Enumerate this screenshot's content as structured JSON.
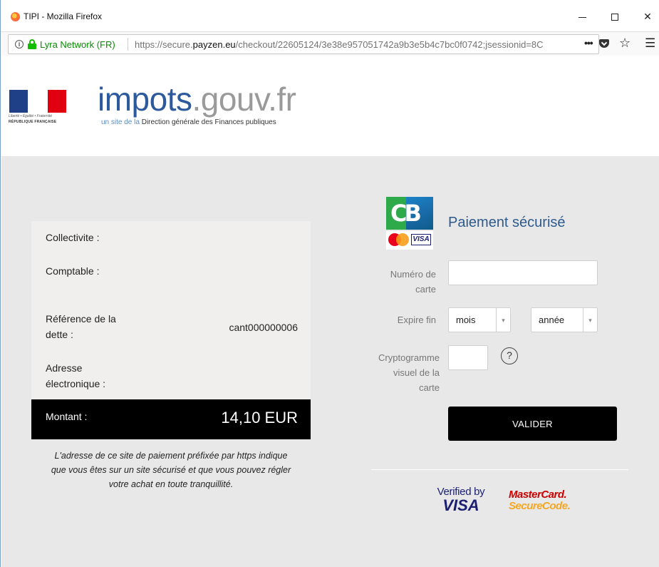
{
  "browser": {
    "window_title": "TIPI - Mozilla Firefox",
    "site_identity": "Lyra Network (FR)",
    "url_prefix": "https://secure.",
    "url_domain": "payzen.eu",
    "url_path": "/checkout/22605124/3e38e957051742a9b3e5b4c7bc0f0742;jsessionid=8C",
    "more_label": "•••",
    "icons": [
      "firefox-icon",
      "info-icon",
      "lock-icon",
      "pocket-icon",
      "star-icon",
      "menu-icon"
    ]
  },
  "header": {
    "brand_impots": "impots",
    "brand_dot": ".",
    "brand_gouv": "gouv.fr",
    "tagline_light": "un site de la",
    "tagline_dark": "Direction générale des Finances publiques",
    "motto": "Liberté • Égalité • Fraternité",
    "republique": "RÉPUBLIQUE FRANÇAISE",
    "flag_colors": [
      "#1f3f86",
      "#ffffff",
      "#e1000f"
    ]
  },
  "summary": {
    "collectivite_label": "Collectivite :",
    "comptable_label": "Comptable :",
    "reference_label_line1": "Référence de la",
    "reference_label_line2": "dette :",
    "reference_value": "cant000000006",
    "email_label_line1": "Adresse",
    "email_label_line2": "électronique :",
    "amount_label": "Montant :",
    "amount_value": "14,10 EUR",
    "note_line1": "L'adresse de ce site de paiement préfixée par https indique",
    "note_line2": "que vous êtes sur un site sécurisé et que vous pouvez régler",
    "note_line3": "votre achat en toute tranquillité."
  },
  "payment": {
    "title": "Paiement sécurisé",
    "cb_logo_text": "CB",
    "visa_mini": "VISA",
    "card_number_label_line1": "Numéro de",
    "card_number_label_line2": "carte",
    "card_number_value": "",
    "expire_label": "Expire fin",
    "month_selected": "mois",
    "year_selected": "année",
    "cvv_label_line1": "Cryptogramme",
    "cvv_label_line2": "visuel de la",
    "cvv_label_line3": "carte",
    "cvv_value": "",
    "help_symbol": "?",
    "submit_label": "VALIDER",
    "vbv_top": "Verified by",
    "vbv_bottom": "VISA",
    "mcsc_top": "MasterCard.",
    "mcsc_bottom": "SecureCode."
  },
  "colors": {
    "page_bg": "#e8e8e8",
    "accent_blue": "#2d5a8c",
    "button_bg": "#000000",
    "secure_green": "#12bc00"
  }
}
